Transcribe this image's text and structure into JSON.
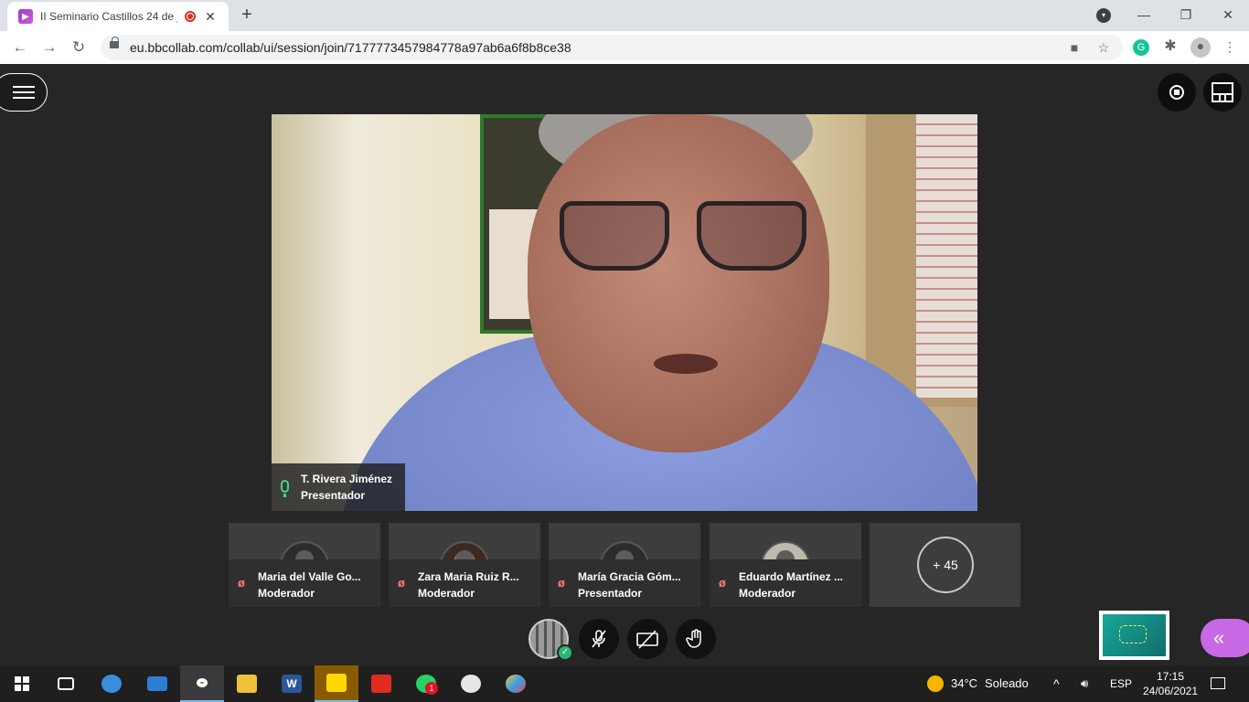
{
  "browser": {
    "tab_title": "II Seminario Castillos 24 de ju",
    "tab_close": "✕",
    "new_tab": "+",
    "url": "eu.bbcollab.com/collab/ui/session/join/7177773457984778a97ab6a6f8b8ce38",
    "window_controls": {
      "minimize": "—",
      "restore": "❐",
      "close": "✕"
    },
    "icons": [
      "back-icon",
      "forward-icon",
      "reload-icon",
      "lock-icon",
      "camera-icon",
      "star-icon",
      "grammarly-icon",
      "extensions-icon",
      "profile-icon",
      "more-icon"
    ]
  },
  "session": {
    "main_video": {
      "name": "T. Rivera Jiménez",
      "role": "Presentador"
    },
    "participants": [
      {
        "name": "Maria del Valle Go...",
        "role": "Moderador"
      },
      {
        "name": "Zara Maria Ruiz R...",
        "role": "Moderador"
      },
      {
        "name": "María Gracia Góm...",
        "role": "Presentador"
      },
      {
        "name": "Eduardo Martínez ...",
        "role": "Moderador"
      }
    ],
    "more_count": "+ 45",
    "controls": [
      "self-avatar",
      "microphone-off-icon",
      "camera-off-icon",
      "raise-hand-icon"
    ]
  },
  "taskbar": {
    "apps": [
      "windows-start-icon",
      "task-view-icon",
      "outlook-icon",
      "mail-icon",
      "chrome-icon",
      "file-explorer-icon",
      "word-icon",
      "sticky-notes-icon",
      "acrobat-icon",
      "whatsapp-icon",
      "app-icon",
      "paint-icon"
    ],
    "whatsapp_badge": "1",
    "weather_temp": "34°C",
    "weather_text": "Soleado",
    "language": "ESP",
    "time": "17:15",
    "date": "24/06/2021"
  },
  "colors": {
    "background": "#262626",
    "mic_active": "#43d38a",
    "muted": "#ff7b70",
    "panel_accent": "#c769e4"
  }
}
